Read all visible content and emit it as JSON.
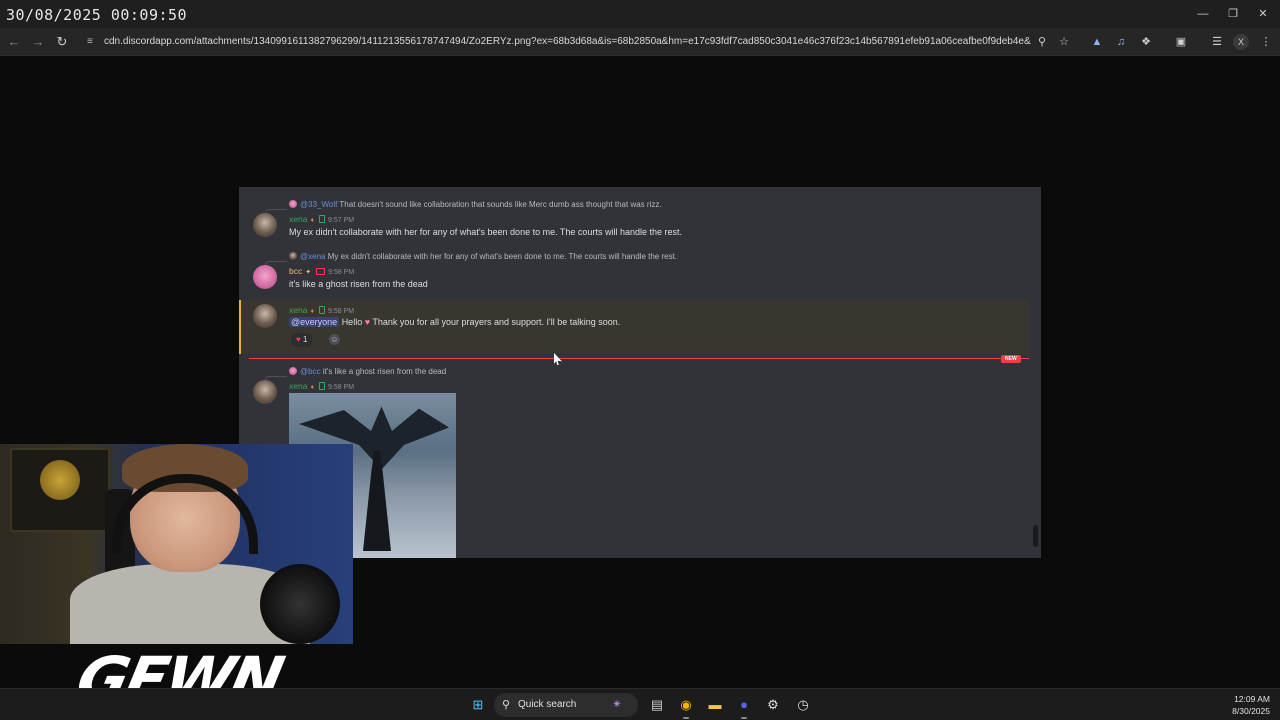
{
  "overlay": {
    "timestamp": "30/08/2025 00:09:50"
  },
  "browser": {
    "url": "cdn.discordapp.com/attachments/1340991611382796299/1411213556178747494/Zo2ERYz.png?ex=68b3d68a&is=68b2850a&hm=e17c93fdf7cad850c3041e46c376f23c14b567891efeb91a06ceafbe0f9deb4e&",
    "window_controls": [
      "minimize",
      "restore",
      "close"
    ]
  },
  "discord": {
    "messages": [
      {
        "reply_to_user": "@33_Wolf",
        "reply_text": "That doesn't sound like collaboration that sounds like Merc dumb ass thought that was rizz.",
        "author": "xena",
        "time": "9:57 PM",
        "text": "My ex didn't collaborate with her for any of what's been done to me. The courts will handle the rest."
      },
      {
        "reply_to_user": "@xena",
        "reply_text": "My ex didn't collaborate with her for any of what's been done to me. The courts will handle the rest.",
        "author": "bcc",
        "time": "9:58 PM",
        "text": "it's like a ghost risen from the dead"
      },
      {
        "author": "xena",
        "time": "9:58 PM",
        "mention": "@everyone",
        "text_before": "Hello",
        "text_after": "Thank you for all your prayers and support. I'll be talking soon.",
        "reaction_count": "1"
      },
      {
        "reply_to_user": "@bcc",
        "reply_text": "it's like a ghost risen from the dead",
        "author": "xena",
        "time": "9:58 PM"
      }
    ],
    "new_badge": "NEW",
    "colors": {
      "xena": "#3ba55c",
      "bcc": "#e8c46a",
      "new_divider": "#f23f43",
      "highlight": "#f0b232"
    }
  },
  "logo": {
    "text": "GEWN"
  },
  "taskbar": {
    "search_label": "Quick search",
    "time": "12:09 AM",
    "date": "8/30/2025",
    "icons": [
      "windows-start-icon",
      "search-icon",
      "task-view-icon",
      "chrome-icon",
      "file-explorer-icon",
      "discord-icon",
      "app-icon",
      "clock-app-icon"
    ]
  }
}
